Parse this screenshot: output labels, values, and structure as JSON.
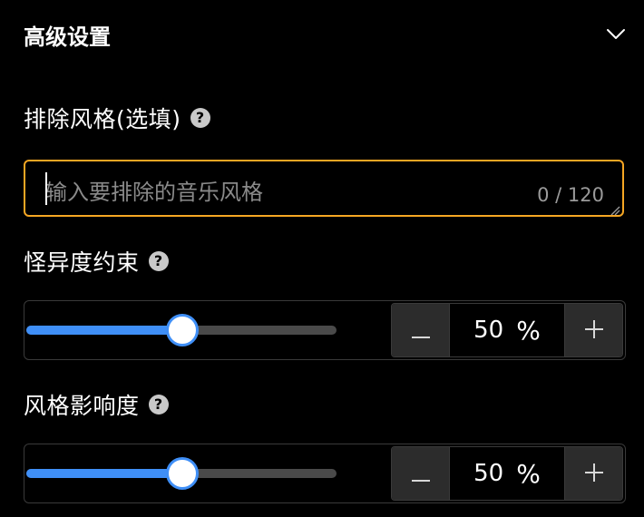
{
  "section": {
    "title": "高级设置",
    "expanded": true
  },
  "exclude_style": {
    "label": "排除风格(选填)",
    "placeholder": "输入要排除的音乐风格",
    "value": "",
    "counter": "0 / 120",
    "max_length": 120
  },
  "weirdness": {
    "label": "怪异度约束",
    "value": "50",
    "unit": "%",
    "percent": 50
  },
  "style_influence": {
    "label": "风格影响度",
    "value": "50",
    "unit": "%",
    "percent": 50
  },
  "colors": {
    "accent": "#3f8ff7",
    "focus_border": "#f5a623",
    "background": "#000000"
  },
  "icons": {
    "collapse": "chevron-down-icon",
    "help": "question-circle-icon",
    "minus": "minus-icon",
    "plus": "plus-icon"
  }
}
